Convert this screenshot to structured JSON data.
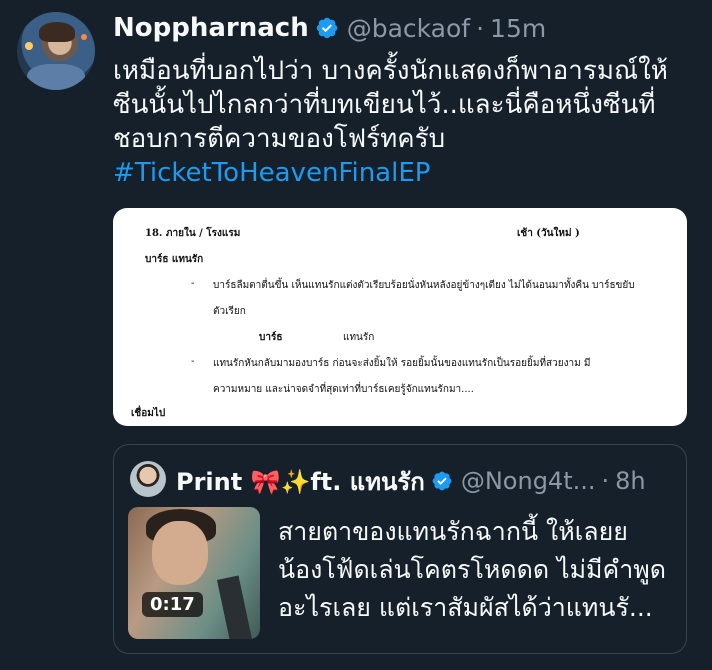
{
  "tweet": {
    "author_name": "Noppharnach",
    "handle": "@backaof",
    "separator": "·",
    "time": "15m",
    "text_lines": [
      "เหมือนที่บอกไปว่า บางครั้งนักแสดงก็พาอารมณ์ให้",
      "ซีนนั้นไปไกลกว่าที่บทเขียนไว้..และนี่คือหนึ่งซีนที่",
      "ชอบการตีความของโฟร์ทครับ"
    ],
    "hashtag": "#TicketToHeavenFinalEP"
  },
  "script_doc": {
    "scene_heading": "18.  ภายใน / โรงแรม",
    "time_of_day": "เช้า (วันใหม่ )",
    "characters": "บาร์ธ  แทนรัก",
    "dash": "-",
    "action1_line1": "บาร์ธลืมตาตื่นขึ้น เห็นแทนรักแต่งตัวเรียบร้อยนั่งหันหลังอยู่ข้างๆเตียง ไม่ได้นอนมาทั้งคืน บาร์ธขยับ",
    "action1_line2": "ตัวเรียก",
    "dialogue_char1": "บาร์ธ",
    "dialogue_char2": "แทนรัก",
    "action2_line1": "แทนรักหันกลับมามองบาร์ธ ก่อนจะส่งยิ้มให้ รอยยิ้มนั้นของแทนรักเป็นรอยยิ้มที่สวยงาม มี",
    "action2_line2": "ความหมาย และน่าจดจำที่สุดเท่าที่บาร์ธเคยรู้จักแทนรักมา....",
    "transition": "เชื่อมไป"
  },
  "quote": {
    "author_name": "Print 🎀✨ft. แทนรัก",
    "handle": "@Nong4t...",
    "separator": "·",
    "time": "8h",
    "video_duration": "0:17",
    "text_lines": [
      "สายตาของแทนรักฉากนี้ ให้เลยย",
      "น้องโฟ้ดเล่นโคตรโหดดด ไม่มีคำพูด",
      "อะไรเลย แต่เราสัมผัสได้ว่าแทนรั..."
    ]
  },
  "colors": {
    "background": "#15202b",
    "accent": "#1d9bf0",
    "secondary_text": "#8b98a5"
  },
  "icons": [
    "verified-badge-icon"
  ]
}
